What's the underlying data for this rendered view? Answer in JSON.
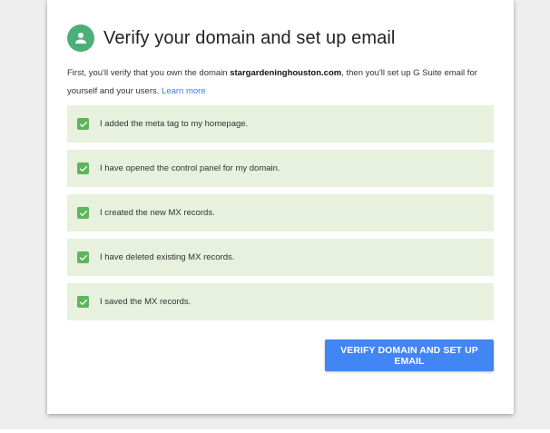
{
  "dialog": {
    "title": "Verify your domain and set up email",
    "avatar_icon": "person-icon",
    "avatar_color": "#4caf78"
  },
  "intro": {
    "text_before": "First, you'll verify that you own the domain ",
    "domain": "stargardeninghouston.com",
    "text_after": ", then you'll set up G Suite email for yourself and your users. ",
    "learn_more": "Learn more"
  },
  "checklist": {
    "item_background": "#e7f1dd",
    "check_color": "#5fb45c",
    "items": [
      {
        "label": "I added the meta tag to my homepage.",
        "checked": true
      },
      {
        "label": "I have opened the control panel for my domain.",
        "checked": true
      },
      {
        "label": "I created the new MX records.",
        "checked": true
      },
      {
        "label": "I have deleted existing MX records.",
        "checked": true
      },
      {
        "label": "I saved the MX records.",
        "checked": true
      }
    ]
  },
  "actions": {
    "verify_label": "VERIFY DOMAIN AND SET UP EMAIL",
    "verify_color": "#4285f4"
  }
}
